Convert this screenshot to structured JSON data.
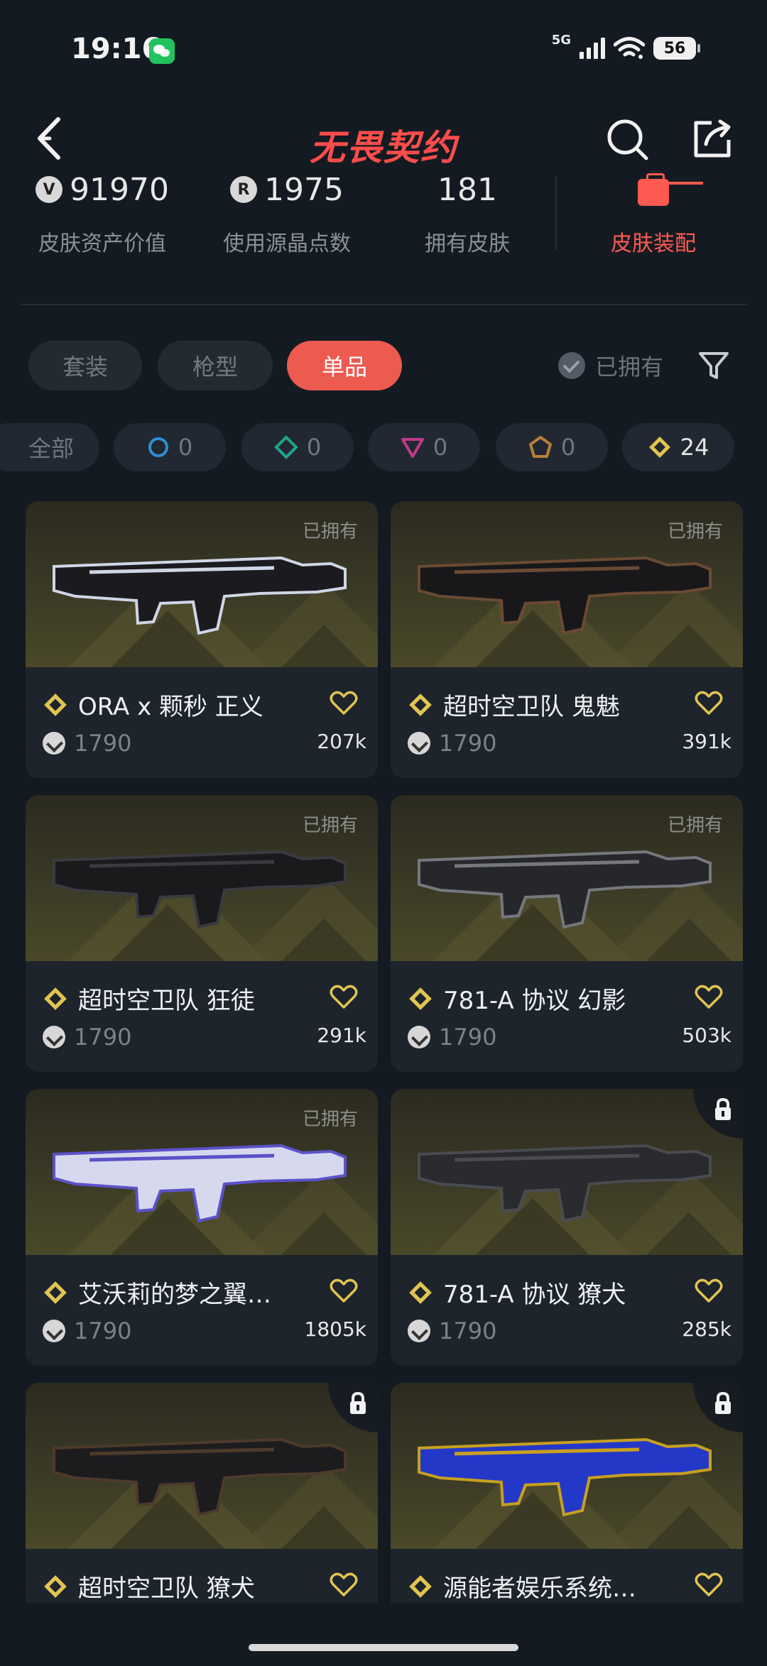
{
  "status_bar": {
    "time": "19:16",
    "network": "5G",
    "battery": "56"
  },
  "header": {
    "logo_text": "无畏契约"
  },
  "stats": [
    {
      "value": "91970",
      "label": "皮肤资产价值",
      "icon": "vp-coin-icon"
    },
    {
      "value": "1975",
      "label": "使用源晶点数",
      "icon": "radianite-coin-icon"
    },
    {
      "value": "181",
      "label": "拥有皮肤"
    },
    {
      "label": "皮肤装配",
      "icon": "equip-icon",
      "color": "#ff5a52"
    }
  ],
  "filters": {
    "tabs": [
      {
        "label": "套装",
        "active": false
      },
      {
        "label": "枪型",
        "active": false
      },
      {
        "label": "单品",
        "active": true
      }
    ],
    "owned_toggle_label": "已拥有"
  },
  "tiers": [
    {
      "label": "全部"
    },
    {
      "icon": "select-tier-icon",
      "count": "0",
      "color": "#2f8fd6"
    },
    {
      "icon": "deluxe-tier-icon",
      "count": "0",
      "color": "#1fa58f"
    },
    {
      "icon": "premium-tier-icon",
      "count": "0",
      "color": "#c2398b"
    },
    {
      "icon": "ultra-tier-icon",
      "count": "0",
      "color": "#b87f37"
    },
    {
      "icon": "exclusive-tier-icon",
      "count": "24",
      "color": "#e1c452"
    }
  ],
  "cards": [
    {
      "name": "ORA x 颗秒 正义",
      "price": "1790",
      "likes": "207k",
      "owned": "已拥有",
      "locked": false
    },
    {
      "name": "超时空卫队 鬼魅",
      "price": "1790",
      "likes": "391k",
      "owned": "已拥有",
      "locked": false
    },
    {
      "name": "超时空卫队 狂徒",
      "price": "1790",
      "likes": "291k",
      "owned": "已拥有",
      "locked": false
    },
    {
      "name": "781-A 协议 幻影",
      "price": "1790",
      "likes": "503k",
      "owned": "已拥有",
      "locked": false
    },
    {
      "name": "艾沃莉的梦之翼…",
      "price": "1790",
      "likes": "1805k",
      "owned": "已拥有",
      "locked": false
    },
    {
      "name": "781-A 协议 獠犬",
      "price": "1790",
      "likes": "285k",
      "owned": "",
      "locked": true
    },
    {
      "name": "超时空卫队 獠犬",
      "price": "",
      "likes": "",
      "owned": "",
      "locked": true
    },
    {
      "name": "源能者娱乐系统…",
      "price": "",
      "likes": "",
      "owned": "",
      "locked": true
    }
  ],
  "colors": {
    "accent": "#ec5a50",
    "tier_gold": "#e1c452",
    "background": "#141a22",
    "card": "#1d242c"
  }
}
